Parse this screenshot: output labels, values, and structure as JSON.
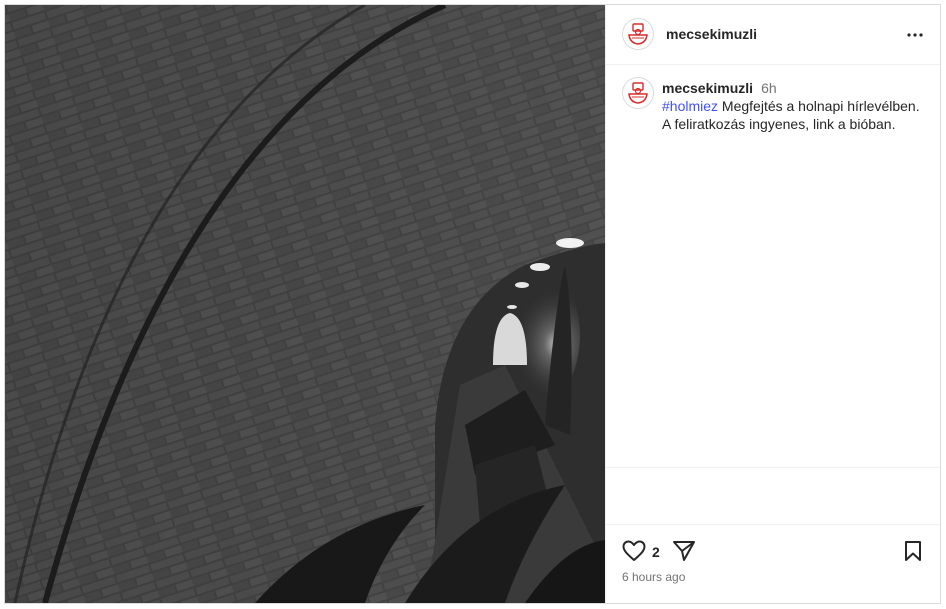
{
  "post": {
    "username": "mecsekimuzli",
    "caption": {
      "username": "mecsekimuzli",
      "time_short": "6h",
      "hashtag": "#holmiez",
      "text": "Megfejtés a holnapi hírlevélben. A feliratkozás ingyenes, link a bióban."
    },
    "like_count": "2",
    "timestamp": "6 hours ago"
  },
  "icons": {
    "avatar": "mecsek-muzli-logo",
    "more": "more-horizontal-icon",
    "like": "heart-outline-icon",
    "share": "paper-plane-icon",
    "save": "bookmark-outline-icon"
  },
  "colors": {
    "hashtag": "#4150f7",
    "logo_red": "#d92b2b",
    "secondary_text": "#737373",
    "divider": "#efefef"
  }
}
